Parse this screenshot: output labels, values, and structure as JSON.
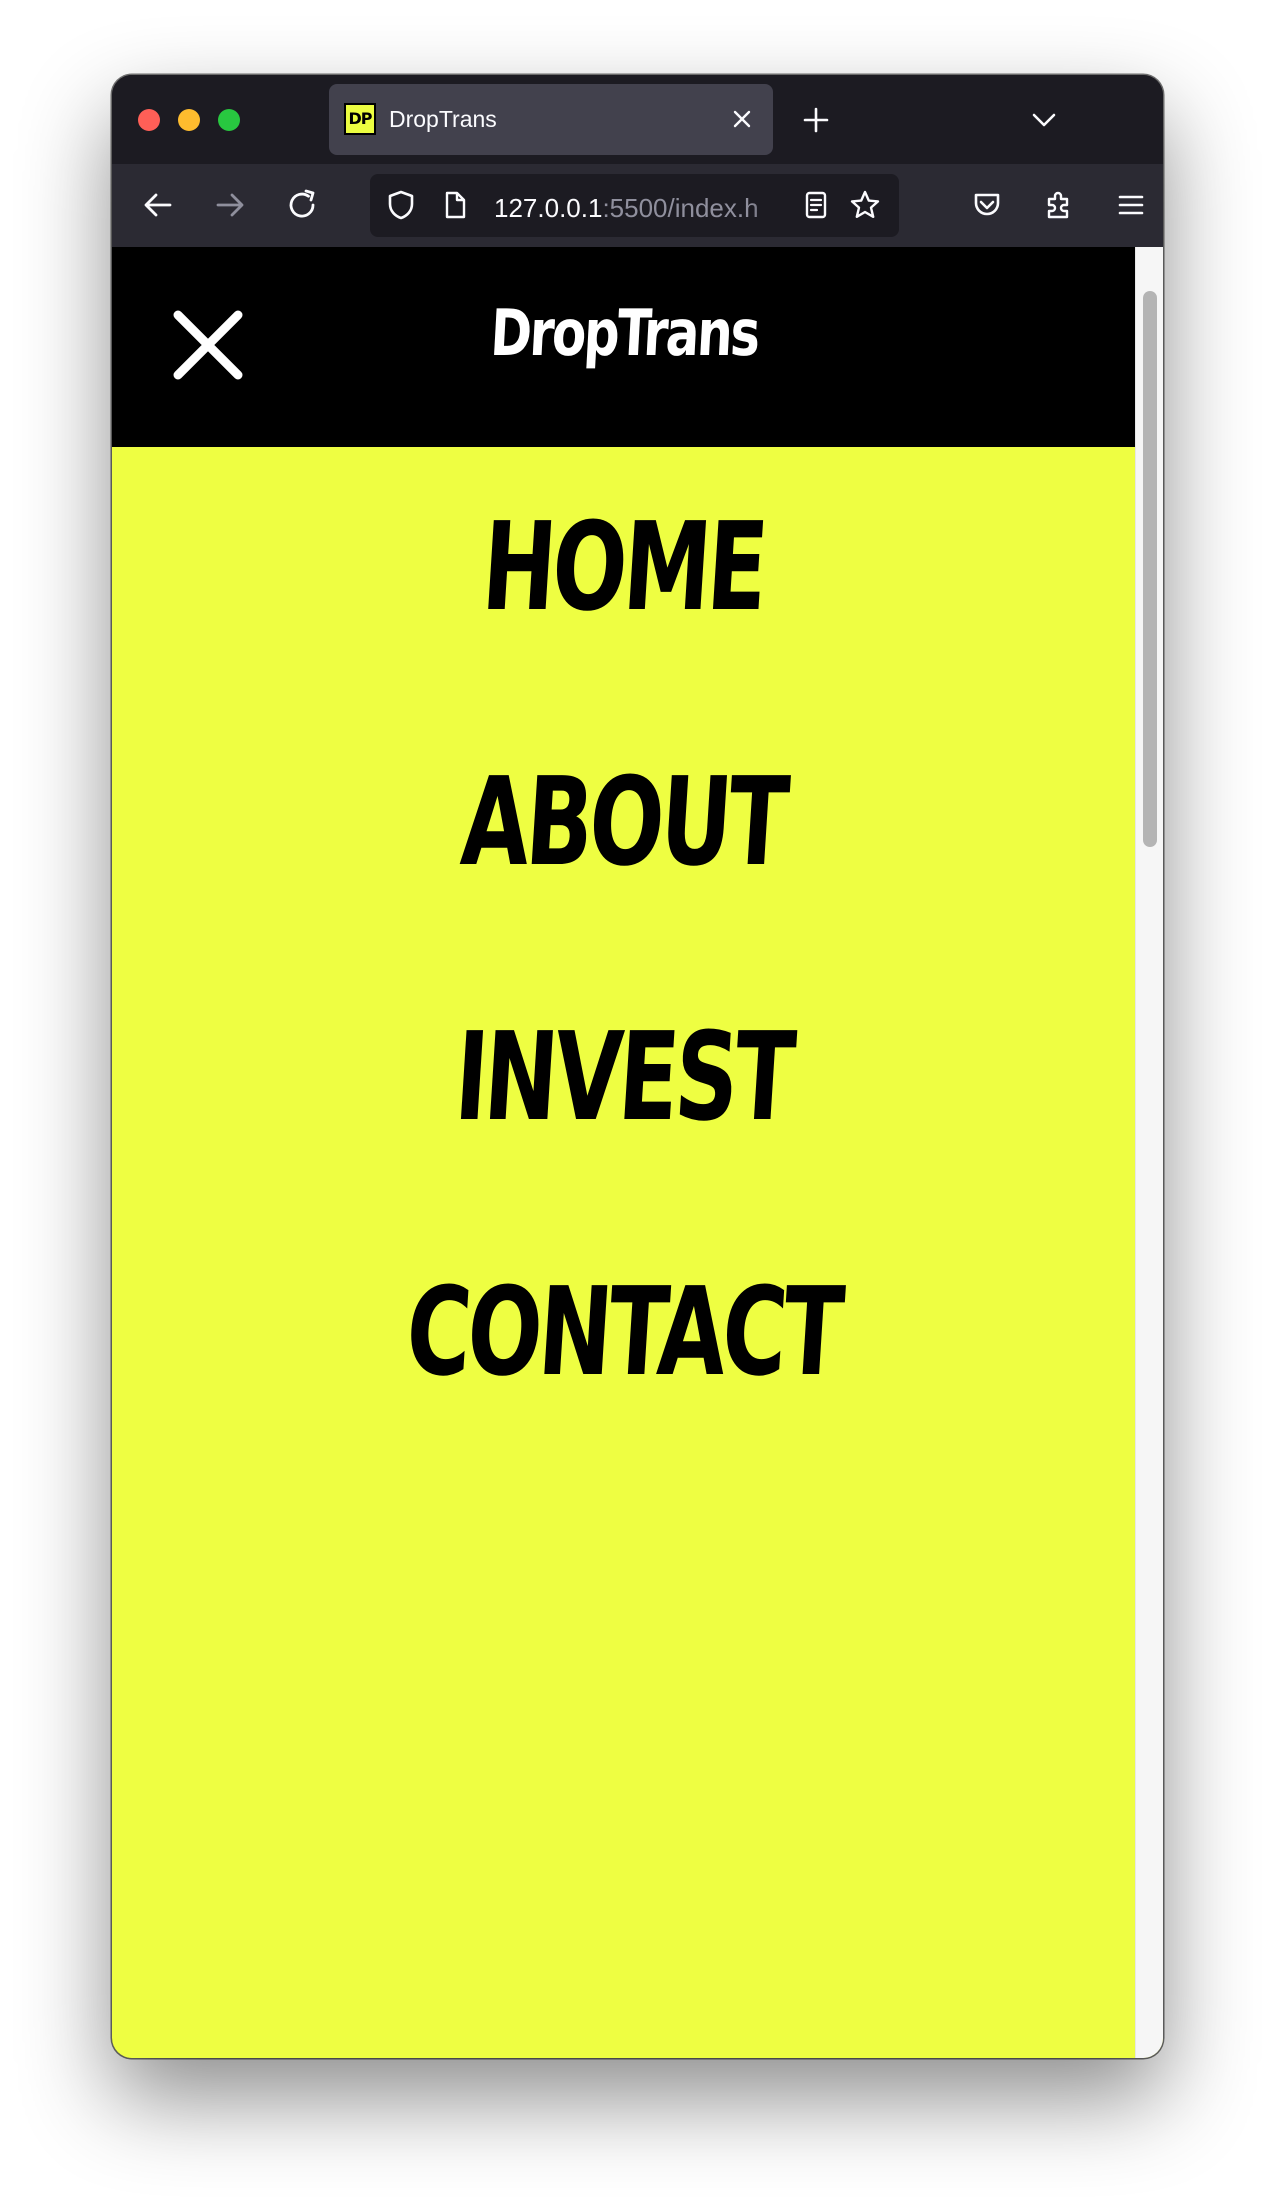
{
  "browser": {
    "tab": {
      "favicon_text": "DP",
      "title": "DropTrans"
    },
    "url": {
      "host": "127.0.0.1",
      "rest": ":5500/index.h"
    },
    "icons": {
      "back": "arrow-left-icon",
      "forward": "arrow-right-icon",
      "reload": "reload-icon",
      "shield": "shield-icon",
      "page": "page-icon",
      "reader": "reader-view-icon",
      "bookmark": "star-icon",
      "pocket": "pocket-icon",
      "extensions": "puzzle-icon",
      "menu": "hamburger-menu-icon",
      "new_tab": "plus-icon",
      "tab_list": "chevron-down-icon",
      "close_tab": "close-icon"
    }
  },
  "site": {
    "brand": "DropTrans",
    "close_icon": "close-icon",
    "menu": [
      {
        "label": "HOME"
      },
      {
        "label": "ABOUT"
      },
      {
        "label": "INVEST"
      },
      {
        "label": "CONTACT"
      }
    ]
  },
  "colors": {
    "accent": "#eefe42",
    "header": "#000000",
    "menu_text": "#000000",
    "brand_text": "#ffffff"
  }
}
